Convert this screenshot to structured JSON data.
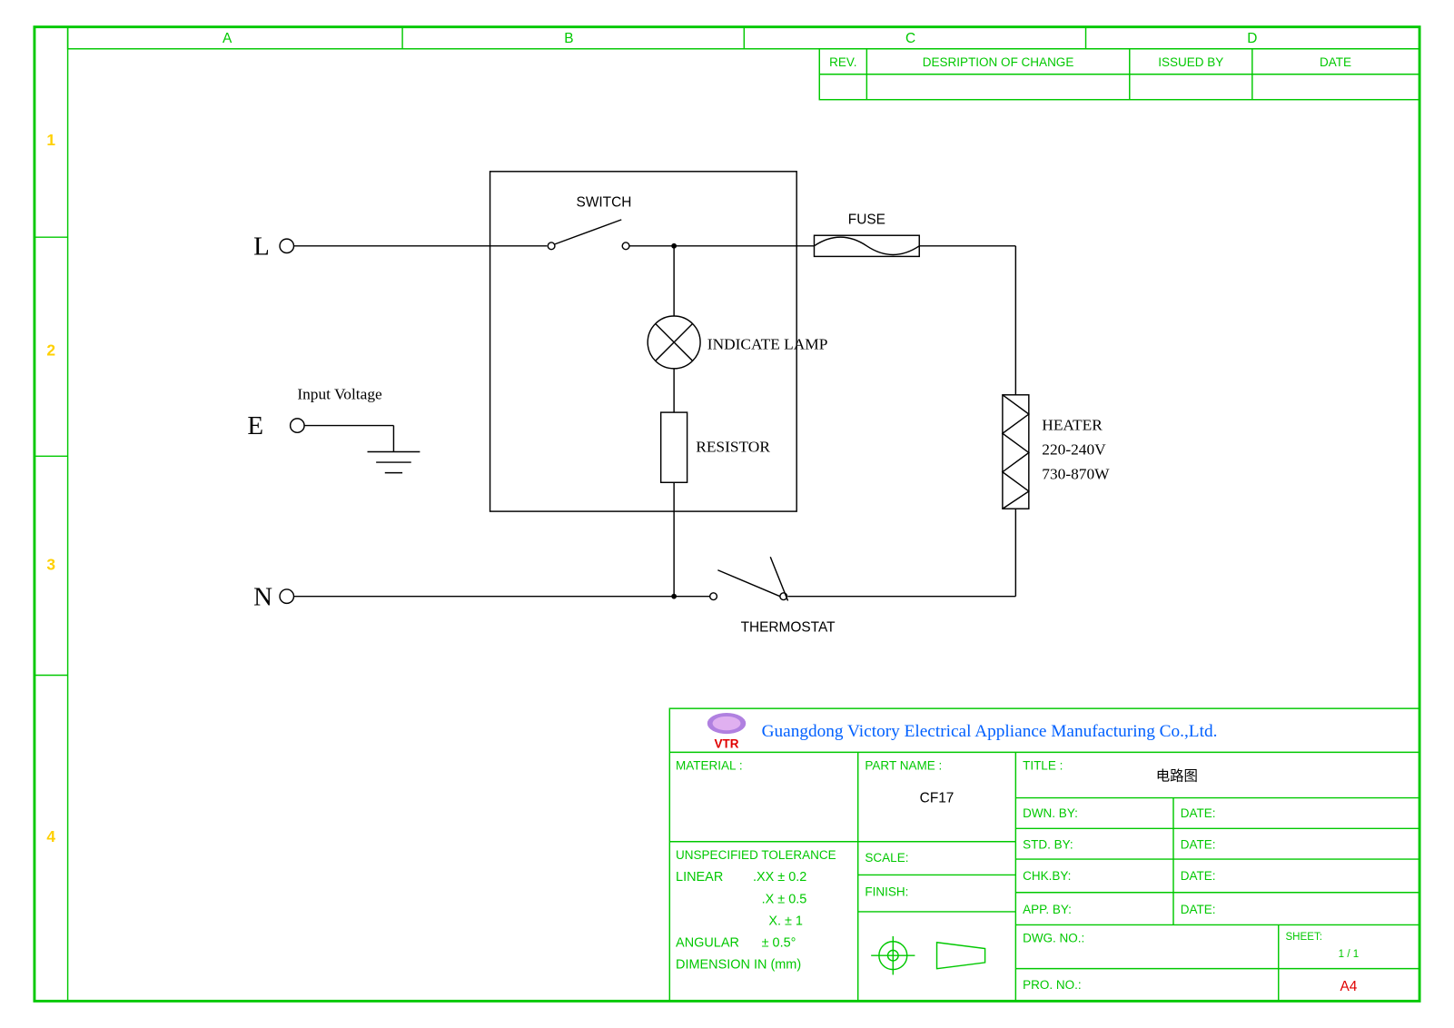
{
  "frame": {
    "cols": [
      "A",
      "B",
      "C",
      "D"
    ],
    "rows": [
      "1",
      "2",
      "3",
      "4"
    ],
    "revHeader": {
      "rev": "REV.",
      "desc": "DESRIPTION OF CHANGE",
      "issued": "ISSUED BY",
      "date": "DATE"
    }
  },
  "circuit": {
    "L": "L",
    "E": "E",
    "N": "N",
    "inputVoltage": "Input Voltage",
    "switch": "SWITCH",
    "fuse": "FUSE",
    "indicateLamp": "INDICATE LAMP",
    "resistor": "RESISTOR",
    "heater": "HEATER",
    "heaterV": "220-240V",
    "heaterW": "730-870W",
    "thermostat": "THERMOSTAT"
  },
  "titleBlock": {
    "company": "Guangdong Victory Electrical Appliance Manufacturing Co.,Ltd.",
    "logo": "VTR",
    "material": "MATERIAL :",
    "partName": "PART NAME :",
    "partValue": "CF17",
    "title": "TITLE :",
    "titleValue": "电路图",
    "dwnBy": "DWN. BY:",
    "date1": "DATE:",
    "stdBy": "STD. BY:",
    "date2": "DATE:",
    "chkBy": "CHK.BY:",
    "date3": "DATE:",
    "appBy": "APP. BY:",
    "date4": "DATE:",
    "dwgNo": "DWG. NO.:",
    "sheet": "SHEET:",
    "sheetVal": "1 / 1",
    "proNo": "PRO. NO.:",
    "size": "A4",
    "unspecTol": "UNSPECIFIED TOLERANCE",
    "linear": "LINEAR",
    "tol1": ".XX ± 0.2",
    "tol2": ".X ± 0.5",
    "tol3": "X. ± 1",
    "angular": "ANGULAR",
    "angTol": "± 0.5°",
    "dimIn": "DIMENSION IN (mm)",
    "scale": "SCALE:",
    "finish": "FINISH:"
  }
}
